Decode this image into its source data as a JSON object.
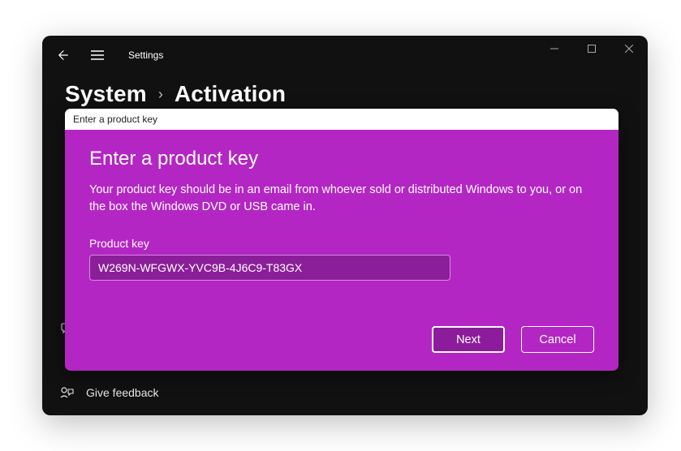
{
  "window": {
    "title": "Settings"
  },
  "breadcrumb": {
    "root": "System",
    "page": "Activation"
  },
  "feedback": {
    "label": "Give feedback"
  },
  "dialog": {
    "titlebar": "Enter a product key",
    "heading": "Enter a product key",
    "description": "Your product key should be in an email from whoever sold or distributed Windows to you, or on the box the Windows DVD or USB came in.",
    "field_label": "Product key",
    "key_value": "W269N-WFGWX-YVC9B-4J6C9-T83GX",
    "next_label": "Next",
    "cancel_label": "Cancel"
  },
  "colors": {
    "dialog_bg": "#b326c4",
    "input_bg": "#8b1e99"
  }
}
